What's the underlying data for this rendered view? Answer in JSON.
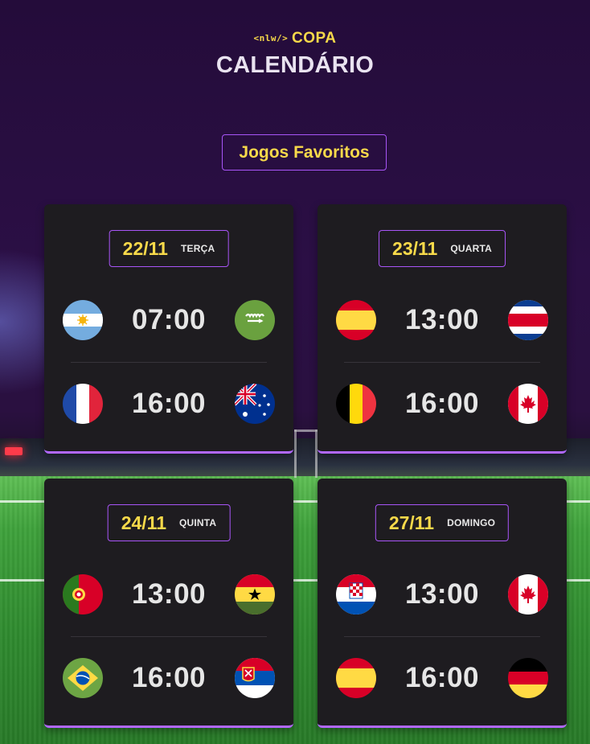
{
  "header": {
    "logo_tag": "<nlw/>",
    "logo_text": "COPA",
    "title": "CALENDÁRIO"
  },
  "favorites_button": "Jogos Favoritos",
  "colors": {
    "accent_yellow": "#f7d94a",
    "accent_purple": "#a855f7",
    "card_bg": "#1e1c20",
    "page_bg": "#231037"
  },
  "cards": [
    {
      "date": "22/11",
      "weekday": "TERÇA",
      "matches": [
        {
          "home_flag": "argentina-flag-icon",
          "time": "07:00",
          "away_flag": "saudi-arabia-flag-icon"
        },
        {
          "home_flag": "france-flag-icon",
          "time": "16:00",
          "away_flag": "australia-flag-icon"
        }
      ]
    },
    {
      "date": "23/11",
      "weekday": "QUARTA",
      "matches": [
        {
          "home_flag": "spain-flag-icon",
          "time": "13:00",
          "away_flag": "costa-rica-flag-icon"
        },
        {
          "home_flag": "belgium-flag-icon",
          "time": "16:00",
          "away_flag": "canada-flag-icon"
        }
      ]
    },
    {
      "date": "24/11",
      "weekday": "QUINTA",
      "matches": [
        {
          "home_flag": "portugal-flag-icon",
          "time": "13:00",
          "away_flag": "ghana-flag-icon"
        },
        {
          "home_flag": "brazil-flag-icon",
          "time": "16:00",
          "away_flag": "serbia-flag-icon"
        }
      ]
    },
    {
      "date": "27/11",
      "weekday": "DOMINGO",
      "matches": [
        {
          "home_flag": "croatia-flag-icon",
          "time": "13:00",
          "away_flag": "canada-flag-icon"
        },
        {
          "home_flag": "spain-flag-icon",
          "time": "16:00",
          "away_flag": "germany-flag-icon"
        }
      ]
    }
  ]
}
